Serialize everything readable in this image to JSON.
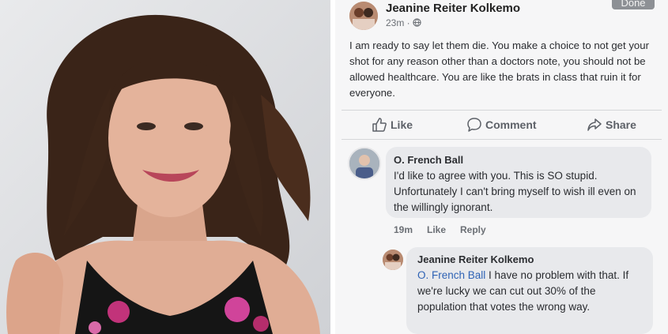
{
  "post": {
    "author": "Jeanine Reiter Kolkemo",
    "time": "23m ·",
    "done_label": "Done",
    "text": "I am ready to say let them die.  You make a choice to not get your shot for any reason other than a doctors note, you should not be allowed healthcare. You are like the brats in class that ruin it for everyone."
  },
  "actions": {
    "like": "Like",
    "comment": "Comment",
    "share": "Share"
  },
  "comments": [
    {
      "author": "O. French Ball",
      "text": "I'd like to agree with you. This is SO stupid. Unfortunately I can't bring myself to wish ill even on the willingly ignorant.",
      "time": "19m",
      "like": "Like",
      "reply": "Reply"
    },
    {
      "author": "Jeanine Reiter Kolkemo",
      "mention": "O. French Ball",
      "text": " I have no problem with that. If we're lucky we can cut out 30% of the population that votes the wrong way."
    }
  ],
  "colors": {
    "mention": "#2f63b5",
    "bubble": "#e8e9ec",
    "panel_bg": "#f6f6f7"
  },
  "icons": [
    "globe-icon",
    "like-icon",
    "comment-icon",
    "share-icon"
  ]
}
